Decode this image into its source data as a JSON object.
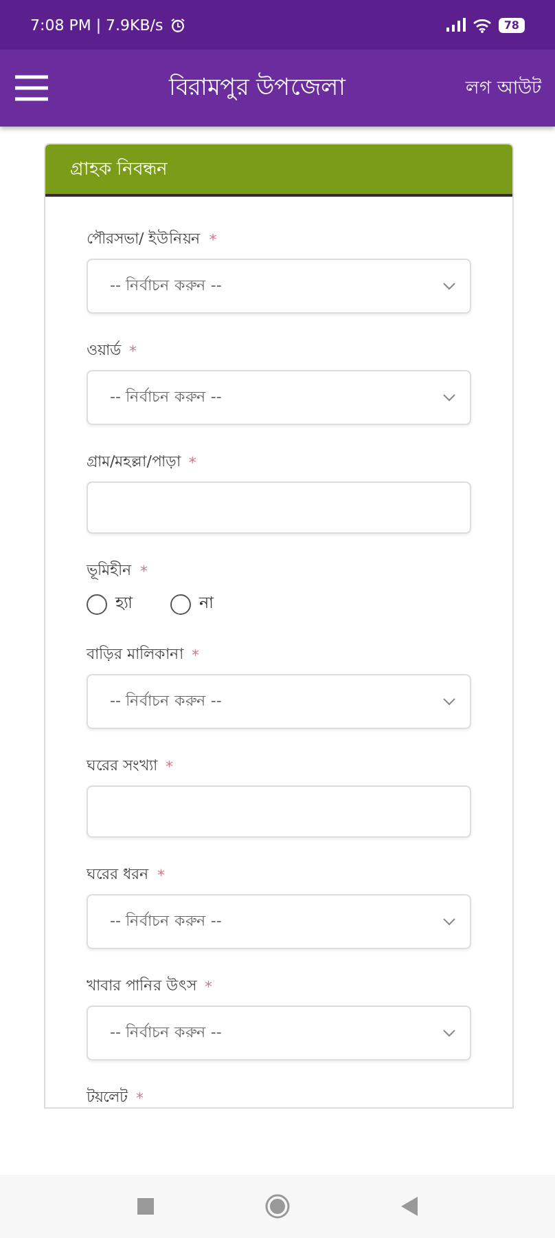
{
  "status_bar": {
    "time": "7:08 PM | 7.9KB/s",
    "battery": "78"
  },
  "app_bar": {
    "title": "বিরামপুর উপজেলা",
    "logout": "লগ আউট"
  },
  "form": {
    "title": "গ্রাহক নিবন্ধন",
    "fields": [
      {
        "kind": "select",
        "label": "পৌরসভা/ ইউনিয়ন",
        "required_mark": "*",
        "placeholder": "-- নির্বাচন করুন --"
      },
      {
        "kind": "select",
        "label": "ওয়ার্ড",
        "required_mark": "*",
        "placeholder": "-- নির্বাচন করুন --"
      },
      {
        "kind": "text",
        "label": "গ্রাম/মহল্লা/পাড়া",
        "required_mark": "*"
      },
      {
        "kind": "radio",
        "label": "ভূমিহীন",
        "required_mark": "*",
        "options": [
          {
            "label": "হ্যা",
            "selected": false
          },
          {
            "label": "না",
            "selected": false
          }
        ]
      },
      {
        "kind": "select",
        "label": "বাড়ির মালিকানা",
        "required_mark": "*",
        "placeholder": "-- নির্বাচন করুন --"
      },
      {
        "kind": "text",
        "label": "ঘরের সংখ্যা",
        "required_mark": "*"
      },
      {
        "kind": "select",
        "label": "ঘরের ধরন",
        "required_mark": "*",
        "placeholder": "-- নির্বাচন করুন --"
      },
      {
        "kind": "select",
        "label": "খাবার পানির উৎস",
        "required_mark": "*",
        "placeholder": "-- নির্বাচন করুন --"
      },
      {
        "kind": "label",
        "label": "টয়লেট",
        "required_mark": "*"
      }
    ]
  }
}
